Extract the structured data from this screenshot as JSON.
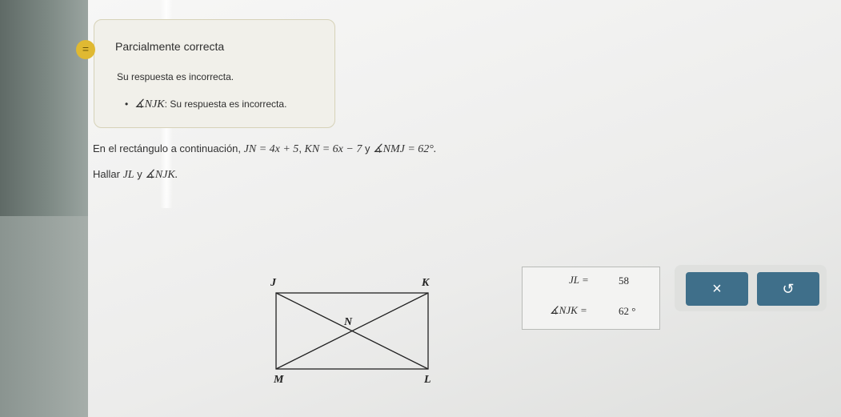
{
  "feedback": {
    "icon": "feedback-equal-icon",
    "icon_glyph": "=",
    "title": "Parcialmente correcta",
    "message": "Su respuesta es incorrecta.",
    "item_symbol": "∡NJK",
    "item_text": ": Su respuesta es incorrecta."
  },
  "problem": {
    "intro": "En el rectángulo a continuación, ",
    "eq1": "JN = 4x + 5",
    "sep1": ", ",
    "eq2": "KN = 6x − 7",
    "conj": " y ",
    "eq3": "∡NMJ = 62°.",
    "ask_prefix": "Hallar ",
    "ask_jl": "JL",
    "ask_y": " y ",
    "ask_angle": "∡NJK."
  },
  "diagram": {
    "label_j": "J",
    "label_k": "K",
    "label_n": "N",
    "label_m": "M",
    "label_l": "L"
  },
  "answers": {
    "jl_label": "JL =",
    "jl_value": "58",
    "angle_label": "∡NJK =",
    "angle_value": "62 °"
  },
  "buttons": {
    "clear_glyph": "×",
    "undo_glyph": "↺"
  },
  "colors": {
    "button": "#3f6f8a",
    "feedback_icon": "#e0b932"
  }
}
